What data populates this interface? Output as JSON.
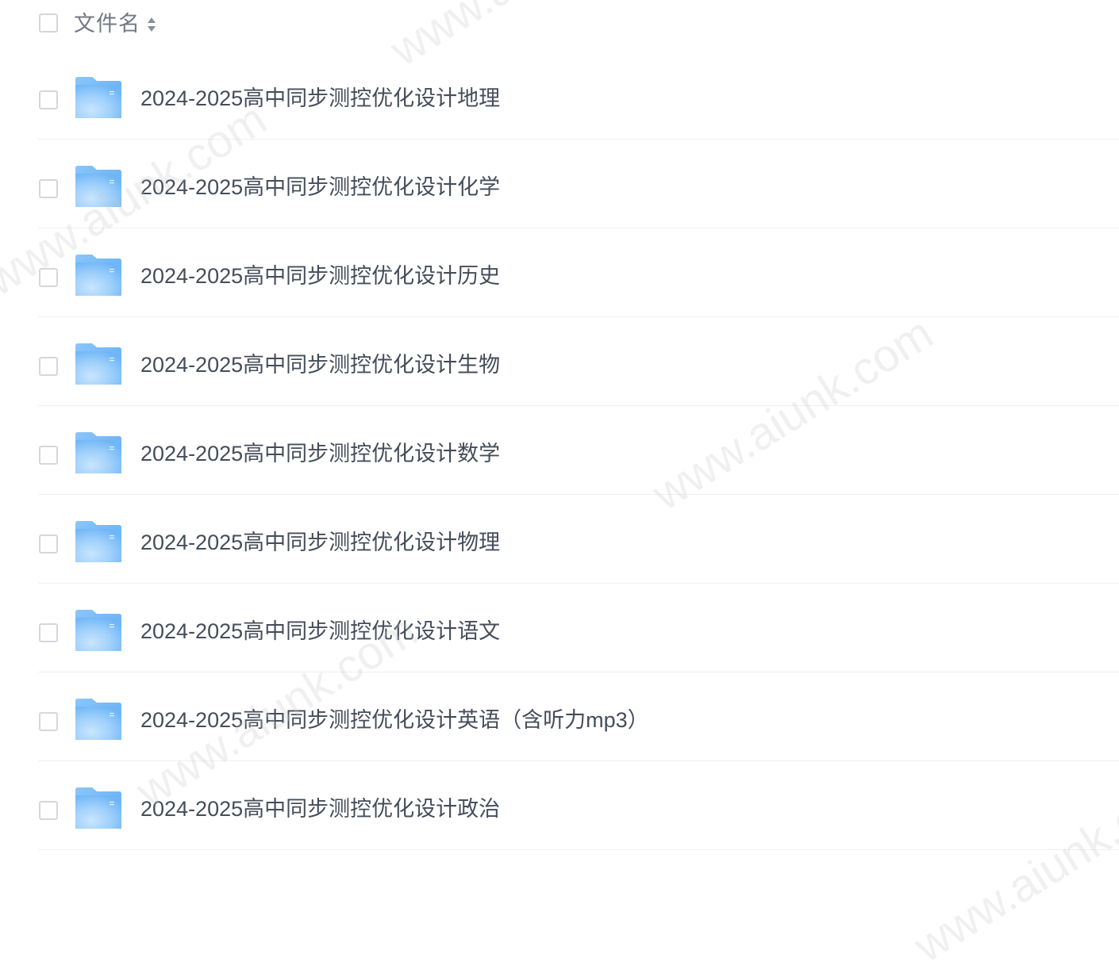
{
  "header": {
    "select_all_checked": false,
    "column_label": "文件名",
    "sort_icon": "sort-icon"
  },
  "files": [
    {
      "name": "2024-2025高中同步测控优化设计地理",
      "icon": "folder-icon",
      "checked": false
    },
    {
      "name": "2024-2025高中同步测控优化设计化学",
      "icon": "folder-icon",
      "checked": false
    },
    {
      "name": "2024-2025高中同步测控优化设计历史",
      "icon": "folder-icon",
      "checked": false
    },
    {
      "name": "2024-2025高中同步测控优化设计生物",
      "icon": "folder-icon",
      "checked": false
    },
    {
      "name": "2024-2025高中同步测控优化设计数学",
      "icon": "folder-icon",
      "checked": false
    },
    {
      "name": "2024-2025高中同步测控优化设计物理",
      "icon": "folder-icon",
      "checked": false
    },
    {
      "name": "2024-2025高中同步测控优化设计语文",
      "icon": "folder-icon",
      "checked": false
    },
    {
      "name": "2024-2025高中同步测控优化设计英语（含听力mp3）",
      "icon": "folder-icon",
      "checked": false
    },
    {
      "name": "2024-2025高中同步测控优化设计政治",
      "icon": "folder-icon",
      "checked": false
    }
  ],
  "watermarks": [
    "www.aiunk.com",
    "www.aiunk.com",
    "www.aiunk.com",
    "www.aiunk.com",
    "www.aiunk.com"
  ],
  "colors": {
    "text": "#454d5a",
    "header_text": "#737882",
    "checkbox_border": "#d4d7dc",
    "divider": "#eef0f3",
    "folder_light": "#a9d4fb",
    "folder_dark": "#5fb1f6"
  }
}
